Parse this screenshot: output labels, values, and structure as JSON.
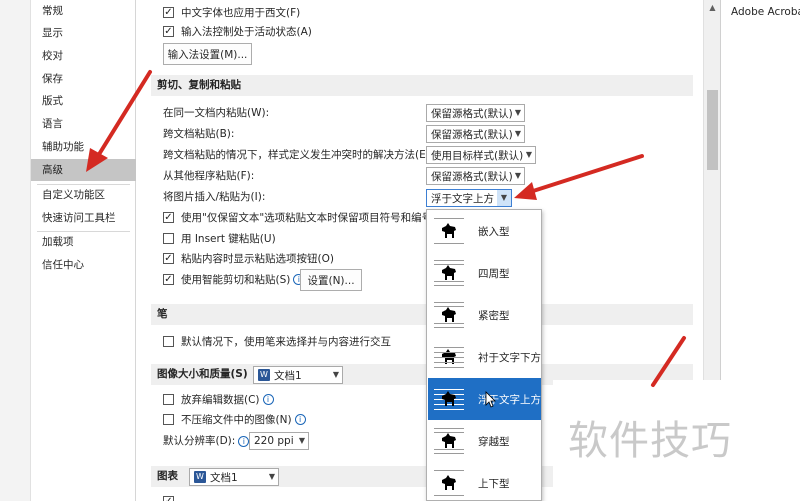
{
  "sidebar": {
    "items": [
      {
        "label": "常规"
      },
      {
        "label": "显示"
      },
      {
        "label": "校对"
      },
      {
        "label": "保存"
      },
      {
        "label": "版式"
      },
      {
        "label": "语言"
      },
      {
        "label": "辅助功能"
      },
      {
        "label": "高级",
        "selected": true
      },
      {
        "label": "自定义功能区"
      },
      {
        "label": "快速访问工具栏"
      },
      {
        "label": "加载项"
      },
      {
        "label": "信任中心"
      }
    ]
  },
  "top_options": {
    "chinese_font_western": "中文字体也应用于西文(F)",
    "ime_active": "输入法控制处于活动状态(A)",
    "ime_settings_button": "输入法设置(M)..."
  },
  "cut_copy_paste": {
    "section_title": "剪切、复制和粘贴",
    "rows": [
      {
        "label": "在同一文档内粘贴(W):",
        "value": "保留源格式(默认)"
      },
      {
        "label": "跨文档粘贴(B):",
        "value": "保留源格式(默认)"
      },
      {
        "label": "跨文档粘贴的情况下，样式定义发生冲突时的解决方法(E):",
        "value": "使用目标样式(默认)"
      },
      {
        "label": "从其他程序粘贴(F):",
        "value": "保留源格式(默认)"
      },
      {
        "label": "将图片插入/粘贴为(I):",
        "value": "浮于文字上方"
      }
    ],
    "keep_text_only": "使用\"仅保留文本\"选项粘贴文本时保留项目符号和编号(L",
    "insert_key": "用 Insert 键粘贴(U)",
    "show_paste_options": "粘贴内容时显示粘贴选项按钮(O)",
    "smart_cut_paste": "使用智能剪切和粘贴(S)",
    "settings_button": "设置(N)..."
  },
  "pen": {
    "section_title": "笔",
    "default_select": "默认情况下，使用笔来选择并与内容进行交互"
  },
  "image_quality": {
    "section_title": "图像大小和质量(S)",
    "document": "文档1",
    "discard_edit": "放弃编辑数据(C)",
    "no_compress": "不压缩文件中的图像(N)",
    "resolution_label": "默认分辨率(D):",
    "resolution_value": "220 ppi"
  },
  "chart": {
    "section_title": "图表",
    "document": "文档1"
  },
  "wrap_popup": {
    "items": [
      {
        "label": "嵌入型"
      },
      {
        "label": "四周型"
      },
      {
        "label": "紧密型"
      },
      {
        "label": "衬于文字下方"
      },
      {
        "label": "浮于文字上方",
        "highlighted": true
      },
      {
        "label": "穿越型"
      },
      {
        "label": "上下型"
      }
    ]
  },
  "right_panel": {
    "app_label": "Adobe Acroba"
  },
  "watermark": "软件技巧",
  "colors": {
    "arrow_red": "#d42a22",
    "highlight_blue": "#1f6fc5",
    "selected_gray": "#c5c5c5",
    "section_gray": "#efefef"
  }
}
